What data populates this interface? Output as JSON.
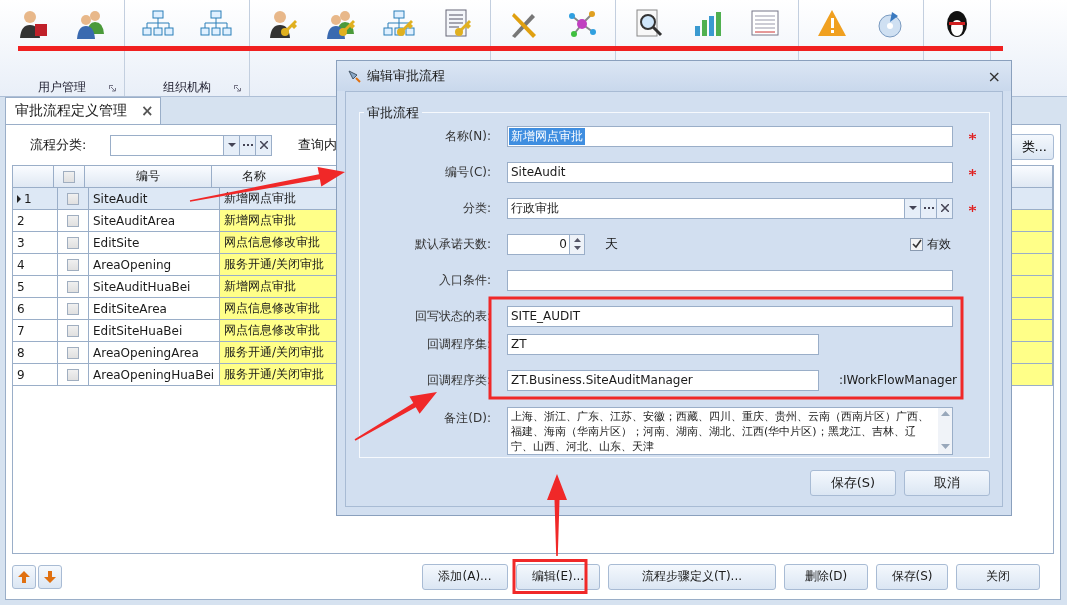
{
  "ribbon": {
    "groups": [
      {
        "label": "用户管理"
      },
      {
        "label": "组织机构"
      }
    ]
  },
  "tabs": [
    {
      "label": "审批流程定义管理",
      "selected": true,
      "close": "×"
    }
  ],
  "filter": {
    "label": "流程分类:",
    "search_label": "查询内",
    "right_button": "类..."
  },
  "grid": {
    "columns": [
      "编号",
      "名称"
    ],
    "header_checked": false,
    "rows": [
      {
        "number": "1",
        "code": "SiteAudit",
        "name": "新增网点审批",
        "selected": true,
        "highlighted": false,
        "checked": false
      },
      {
        "number": "2",
        "code": "SiteAuditArea",
        "name": "新增网点审批",
        "selected": false,
        "highlighted": true,
        "checked": false
      },
      {
        "number": "3",
        "code": "EditSite",
        "name": "网点信息修改审批",
        "selected": false,
        "highlighted": true,
        "checked": false
      },
      {
        "number": "4",
        "code": "AreaOpening",
        "name": "服务开通/关闭审批",
        "selected": false,
        "highlighted": true,
        "checked": false
      },
      {
        "number": "5",
        "code": "SiteAuditHuaBei",
        "name": "新增网点审批",
        "selected": false,
        "highlighted": true,
        "checked": false
      },
      {
        "number": "6",
        "code": "EditSiteArea",
        "name": "网点信息修改审批",
        "selected": false,
        "highlighted": true,
        "checked": false
      },
      {
        "number": "7",
        "code": "EditSiteHuaBei",
        "name": "网点信息修改审批",
        "selected": false,
        "highlighted": true,
        "checked": false
      },
      {
        "number": "8",
        "code": "AreaOpeningArea",
        "name": "服务开通/关闭审批",
        "selected": false,
        "highlighted": true,
        "checked": false
      },
      {
        "number": "9",
        "code": "AreaOpeningHuaBei",
        "name": "服务开通/关闭审批",
        "selected": false,
        "highlighted": true,
        "checked": false
      }
    ]
  },
  "buttons": [
    "添加(A)...",
    "编辑(E)...",
    "流程步骤定义(T)...",
    "删除(D)",
    "保存(S)",
    "关闭"
  ],
  "dialog": {
    "title": "编辑审批流程",
    "close": "×",
    "group": "审批流程",
    "fields": [
      {
        "kind": "text",
        "label": "名称(N):",
        "value": "新增网点审批",
        "required": true,
        "highlighted": true
      },
      {
        "kind": "text",
        "label": "编号(C):",
        "value": "SiteAudit",
        "required": true
      },
      {
        "kind": "combo",
        "label": "分类:",
        "value": "行政审批",
        "required": true
      },
      {
        "kind": "spin",
        "label": "默认承诺天数:",
        "value": "0",
        "unit": "天",
        "check_label": "有效",
        "checked": true
      },
      {
        "kind": "text",
        "label": "入口条件:"
      },
      {
        "kind": "text",
        "label": "回写状态的表:",
        "value": "SITE_AUDIT"
      },
      {
        "kind": "short",
        "label": "回调程序集:",
        "value": "ZT"
      },
      {
        "kind": "short",
        "label": "回调程序类:",
        "value": "ZT.Business.SiteAuditManager",
        "suffix": ":IWorkFlowManager"
      },
      {
        "kind": "memo",
        "label": "备注(D):",
        "value": "上海、浙江、广东、江苏、安徽；西藏、四川、重庆、贵州、云南（西南片区）广西、福建、海南（华南片区）；河南、湖南、湖北、江西(华中片区)；黑龙江、吉林、辽宁、山西、河北、山东、天津"
      }
    ],
    "buttons": [
      "保存(S)",
      "取消"
    ]
  }
}
